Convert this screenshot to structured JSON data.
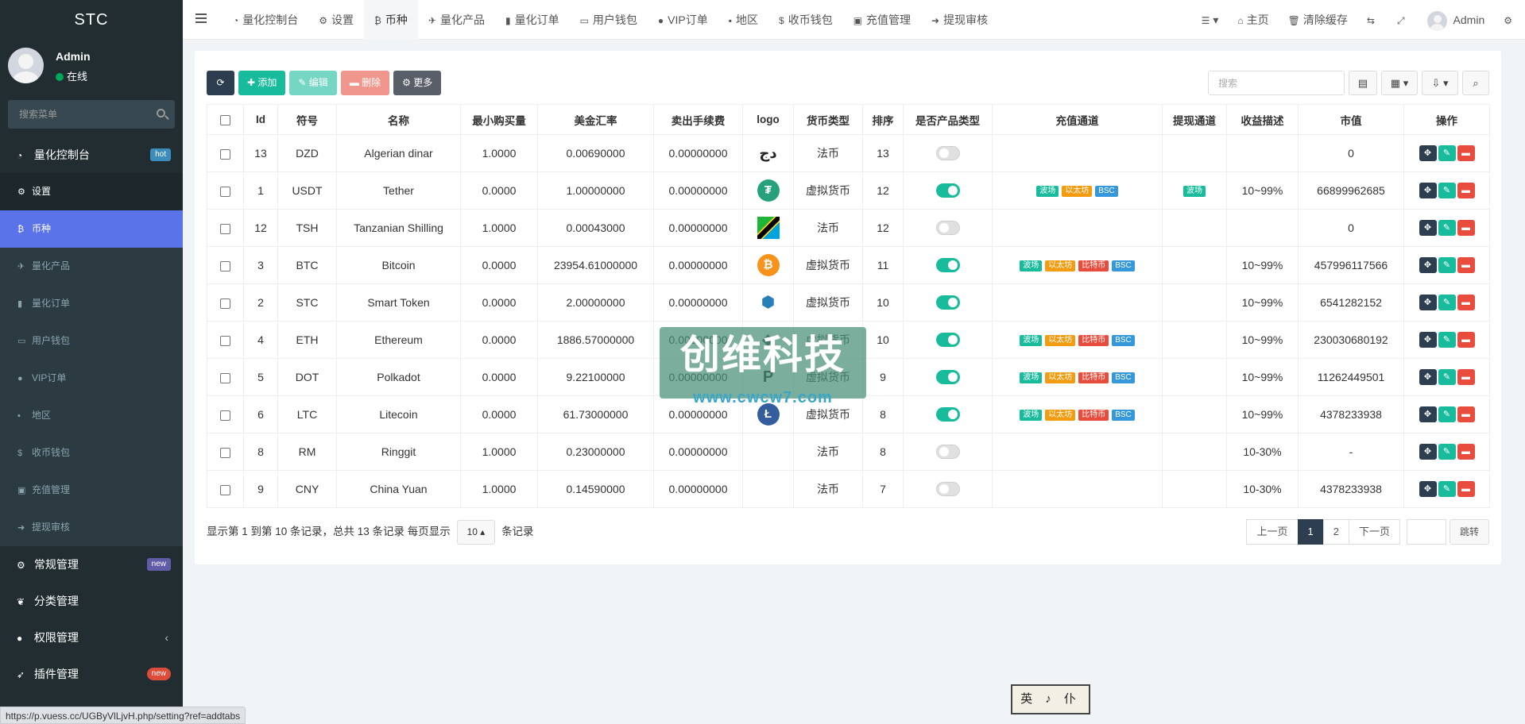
{
  "brand": "STC",
  "user": {
    "name": "Admin",
    "status": "在线"
  },
  "sidebar": {
    "search_placeholder": "搜索菜单",
    "main": {
      "label": "量化控制台",
      "badge": "hot"
    },
    "sub_items": [
      {
        "label": "设置",
        "icon": "gear-icon"
      },
      {
        "label": "币种",
        "icon": "bitcoin-icon"
      },
      {
        "label": "量化产品",
        "icon": "plane-icon"
      },
      {
        "label": "量化订单",
        "icon": "book-icon"
      },
      {
        "label": "用户钱包",
        "icon": "wallet-icon"
      },
      {
        "label": "VIP订单",
        "icon": "vip-icon"
      },
      {
        "label": "地区",
        "icon": "map-icon"
      },
      {
        "label": "收币钱包",
        "icon": "dollar-icon"
      },
      {
        "label": "充值管理",
        "icon": "money-icon"
      },
      {
        "label": "提现审核",
        "icon": "arrow-circle-icon"
      }
    ],
    "groups": [
      {
        "label": "常规管理",
        "badge": "new"
      },
      {
        "label": "分类管理"
      },
      {
        "label": "权限管理"
      },
      {
        "label": "插件管理",
        "badge": "new"
      }
    ]
  },
  "topnav": {
    "tabs": [
      {
        "label": "量化控制台",
        "icon": "dashboard-icon"
      },
      {
        "label": "设置",
        "icon": "gear-icon"
      },
      {
        "label": "币种",
        "icon": "bitcoin-icon"
      },
      {
        "label": "量化产品",
        "icon": "plane-icon"
      },
      {
        "label": "量化订单",
        "icon": "book-icon"
      },
      {
        "label": "用户钱包",
        "icon": "wallet-icon"
      },
      {
        "label": "VIP订单",
        "icon": "vip-icon"
      },
      {
        "label": "地区",
        "icon": "map-icon"
      },
      {
        "label": "收币钱包",
        "icon": "dollar-icon"
      },
      {
        "label": "充值管理",
        "icon": "money-icon"
      },
      {
        "label": "提现审核",
        "icon": "arrow-circle-icon"
      }
    ],
    "home": "主页",
    "clear_cache": "清除缓存",
    "admin": "Admin"
  },
  "toolbar": {
    "add": "添加",
    "edit": "编辑",
    "delete": "删除",
    "more": "更多",
    "search_placeholder": "搜索"
  },
  "table": {
    "columns": [
      "Id",
      "符号",
      "名称",
      "最小购买量",
      "美金汇率",
      "卖出手续费",
      "logo",
      "货币类型",
      "排序",
      "是否产品类型",
      "充值通道",
      "提现通道",
      "收益描述",
      "市值",
      "操作"
    ],
    "rows": [
      {
        "id": "13",
        "symbol": "DZD",
        "name": "Algerian dinar",
        "min": "1.0000",
        "rate": "0.00690000",
        "fee": "0.00000000",
        "logo": "dzd",
        "type": "法币",
        "sort": "13",
        "product": false,
        "deposit": [],
        "withdraw": [],
        "yield": "",
        "cap": "0"
      },
      {
        "id": "1",
        "symbol": "USDT",
        "name": "Tether",
        "min": "0.0000",
        "rate": "1.00000000",
        "fee": "0.00000000",
        "logo": "usdt",
        "type": "虚拟货币",
        "sort": "12",
        "product": true,
        "deposit": [
          "波场",
          "以太坊",
          "BSC"
        ],
        "withdraw": [
          "波场"
        ],
        "yield": "10~99%",
        "cap": "66899962685"
      },
      {
        "id": "12",
        "symbol": "TSH",
        "name": "Tanzanian Shilling",
        "min": "1.0000",
        "rate": "0.00043000",
        "fee": "0.00000000",
        "logo": "tsh",
        "type": "法币",
        "sort": "12",
        "product": false,
        "deposit": [],
        "withdraw": [],
        "yield": "",
        "cap": "0"
      },
      {
        "id": "3",
        "symbol": "BTC",
        "name": "Bitcoin",
        "min": "0.0000",
        "rate": "23954.61000000",
        "fee": "0.00000000",
        "logo": "btc",
        "type": "虚拟货币",
        "sort": "11",
        "product": true,
        "deposit": [
          "波场",
          "以太坊",
          "比特币",
          "BSC"
        ],
        "withdraw": [],
        "yield": "10~99%",
        "cap": "457996117566"
      },
      {
        "id": "2",
        "symbol": "STC",
        "name": "Smart Token",
        "min": "0.0000",
        "rate": "2.00000000",
        "fee": "0.00000000",
        "logo": "stc",
        "type": "虚拟货币",
        "sort": "10",
        "product": true,
        "deposit": [],
        "withdraw": [],
        "yield": "10~99%",
        "cap": "6541282152"
      },
      {
        "id": "4",
        "symbol": "ETH",
        "name": "Ethereum",
        "min": "0.0000",
        "rate": "1886.57000000",
        "fee": "0.00000000",
        "logo": "eth",
        "type": "虚拟货币",
        "sort": "10",
        "product": true,
        "deposit": [
          "波场",
          "以太坊",
          "比特币",
          "BSC"
        ],
        "withdraw": [],
        "yield": "10~99%",
        "cap": "230030680192"
      },
      {
        "id": "5",
        "symbol": "DOT",
        "name": "Polkadot",
        "min": "0.0000",
        "rate": "9.22100000",
        "fee": "0.00000000",
        "logo": "dot",
        "type": "虚拟货币",
        "sort": "9",
        "product": true,
        "deposit": [
          "波场",
          "以太坊",
          "比特币",
          "BSC"
        ],
        "withdraw": [],
        "yield": "10~99%",
        "cap": "11262449501"
      },
      {
        "id": "6",
        "symbol": "LTC",
        "name": "Litecoin",
        "min": "0.0000",
        "rate": "61.73000000",
        "fee": "0.00000000",
        "logo": "ltc",
        "type": "虚拟货币",
        "sort": "8",
        "product": true,
        "deposit": [
          "波场",
          "以太坊",
          "比特币",
          "BSC"
        ],
        "withdraw": [],
        "yield": "10~99%",
        "cap": "4378233938"
      },
      {
        "id": "8",
        "symbol": "RM",
        "name": "Ringgit",
        "min": "1.0000",
        "rate": "0.23000000",
        "fee": "0.00000000",
        "logo": "",
        "type": "法币",
        "sort": "8",
        "product": false,
        "deposit": [],
        "withdraw": [],
        "yield": "10-30%",
        "cap": "-"
      },
      {
        "id": "9",
        "symbol": "CNY",
        "name": "China Yuan",
        "min": "1.0000",
        "rate": "0.14590000",
        "fee": "0.00000000",
        "logo": "",
        "type": "法币",
        "sort": "7",
        "product": false,
        "deposit": [],
        "withdraw": [],
        "yield": "10-30%",
        "cap": "4378233938"
      }
    ]
  },
  "pagination": {
    "info_prefix": "显示第 1 到第 10 条记录，总共 13 条记录 每页显示",
    "page_size": "10",
    "info_suffix": "条记录",
    "prev": "上一页",
    "pages": [
      "1",
      "2"
    ],
    "next": "下一页",
    "go": "跳转"
  },
  "watermark": {
    "text": "创维科技",
    "url": "www.cwcw7.com"
  },
  "lang_box": "英 ♪ 仆",
  "status_url": "https://p.vuess.cc/UGByVlLjvH.php/setting?ref=addtabs",
  "colors": {
    "sidebar": "#222d32",
    "accent": "#18bc9c",
    "active_sub": "#5b73e8",
    "danger": "#e74c3c"
  }
}
